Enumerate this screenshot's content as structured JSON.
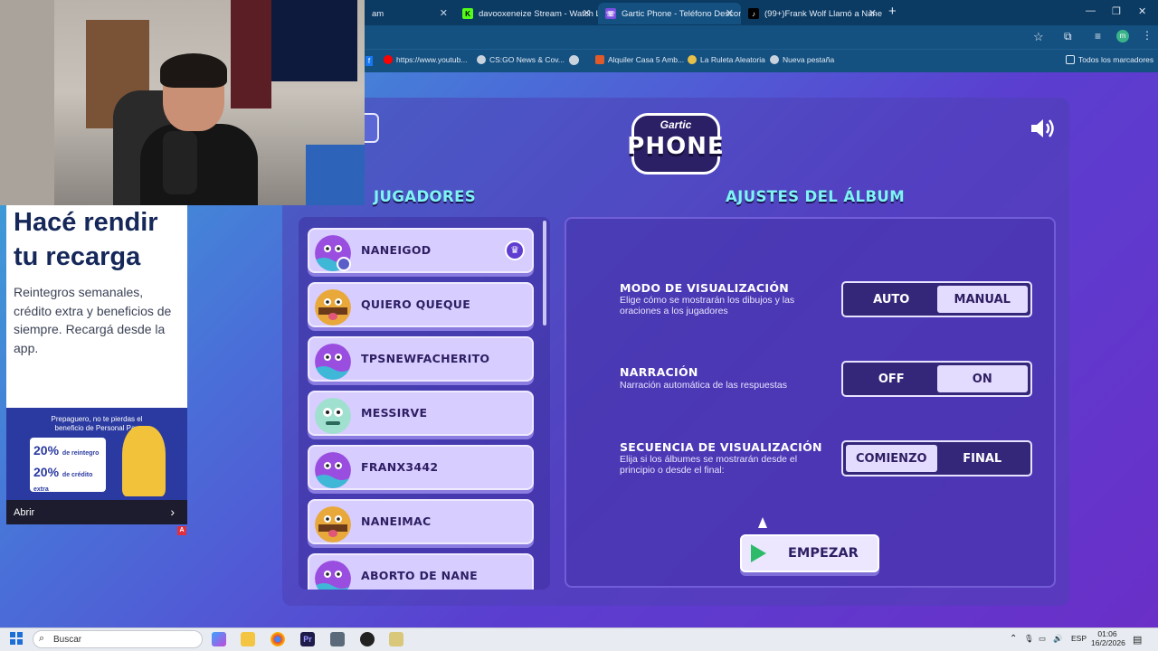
{
  "browser": {
    "tabs": [
      {
        "label": "am",
        "icon": "stream-icon"
      },
      {
        "label": "davooxeneize Stream - Watch L",
        "icon": "kick-icon"
      },
      {
        "label": "Gartic Phone - Teléfono Descon",
        "icon": "gartic-icon"
      },
      {
        "label": "(99+)Frank Wolf Llamó a Nane",
        "icon": "tiktok-icon"
      }
    ],
    "new_tab": "+",
    "bookmarks": [
      {
        "label": "https://www.youtub..."
      },
      {
        "label": "CS:GO News & Cov..."
      },
      {
        "label": "Alquiler Casa 5 Amb..."
      },
      {
        "label": "La Ruleta Aleatoria"
      },
      {
        "label": "Nueva pestaña"
      }
    ],
    "all_bookmarks": "Todos los marcadores",
    "profile_initial": "m"
  },
  "game": {
    "logo_top": "Gartic",
    "logo_main": "PHONE",
    "players_heading": "JUGADORES",
    "settings_heading": "AJUSTES DEL ÁLBUM",
    "players": [
      {
        "name": "NANEIGOD",
        "avatar": "purple",
        "host": true
      },
      {
        "name": "QUIERO QUEQUE",
        "avatar": "yellow",
        "host": false
      },
      {
        "name": "TPSNEWFACHERITO",
        "avatar": "purple",
        "host": false
      },
      {
        "name": "MESSIRVE",
        "avatar": "mint",
        "host": false
      },
      {
        "name": "FRANX3442",
        "avatar": "purple",
        "host": false
      },
      {
        "name": "NANEIMAC",
        "avatar": "yellow",
        "host": false
      },
      {
        "name": "ABORTO DE NANE",
        "avatar": "purple",
        "host": false
      }
    ],
    "settings": [
      {
        "title": "MODO DE VISUALIZACIÓN",
        "desc": "Elige cómo se mostrarán los dibujos y las oraciones a los jugadores",
        "options": [
          "AUTO",
          "MANUAL"
        ],
        "selected": 1
      },
      {
        "title": "NARRACIÓN",
        "desc": "Narración automática de las respuestas",
        "options": [
          "OFF",
          "ON"
        ],
        "selected": 1
      },
      {
        "title": "SECUENCIA DE VISUALIZACIÓN",
        "desc": "Elija si los álbumes se mostrarán desde el principio o desde el final:",
        "options": [
          "COMIENZO",
          "FINAL"
        ],
        "selected": 0
      }
    ],
    "start_label": "EMPEZAR"
  },
  "ad": {
    "headline": "Hacé rendir tu recarga",
    "body": "Reintegros semanales, crédito extra y beneficios de siempre. Recargá desde la app.",
    "image_line1": "Prepaguero, no te pierdas el",
    "image_line2": "beneficio de Personal Pay",
    "promo1": "20%",
    "promo1_text": "de reintegro",
    "promo2": "20%",
    "promo2_text": "de crédito extra",
    "cta": "Abrir",
    "badge": "A"
  },
  "taskbar": {
    "search_placeholder": "Buscar",
    "lang": "ESP",
    "time": "01:06",
    "date": "16/2/2026"
  },
  "colors": {
    "accent_heading": "#7ef4f4",
    "card": "#d7cdff",
    "play_green": "#2dbb6a"
  }
}
